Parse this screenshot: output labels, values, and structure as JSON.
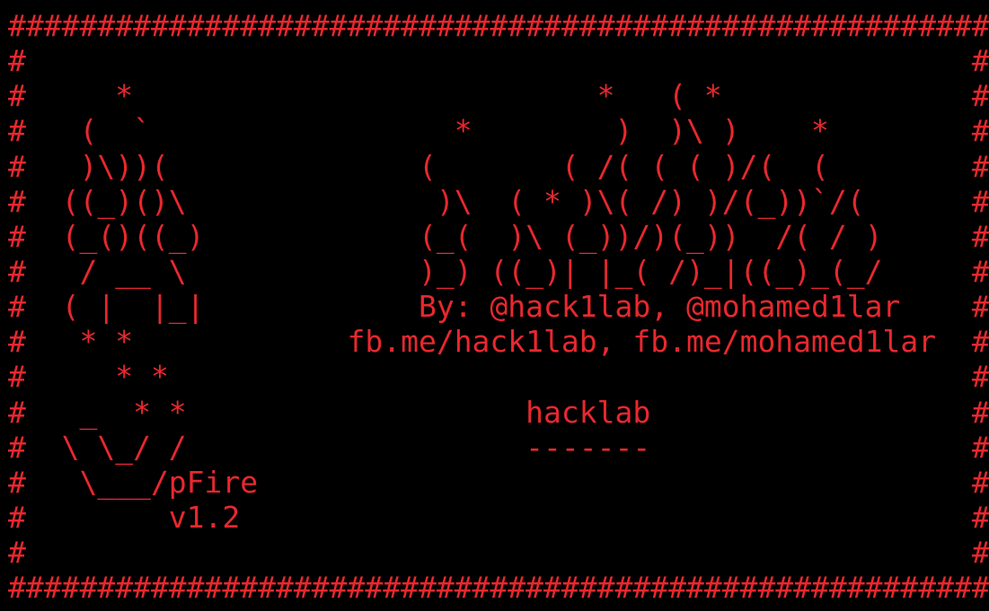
{
  "terminal": {
    "text_color": "#e8282e",
    "background_color": "#000000",
    "banner_lines": [
      "#######################################################",
      "#                                                     #",
      "#     *                          *   ( *              #",
      "#   (  `                 *        )  )\\ )    *        #",
      "#   )\\))(              (       ( /( ( ( )/(  (        #",
      "#  ((_)()\\              )\\  ( * )\\( /) )/(_))`/(      #",
      "#  (_()((_)            (_(  )\\ (_))/)(_))  /( / )     #",
      "#   / __ \\             )_) ((_)| |_( /)_|((_)_(_/     #",
      "#  ( |  |_|            By: @hack1lab, @mohamed1lar    #",
      "#   * *            fb.me/hack1lab, fb.me/mohamed1lar  #",
      "#     * *                                             #",
      "#   _  * *                   hacklab                  #",
      "#  \\ \\_/ /                   -------                  #",
      "#   \\___/pFire                                        #",
      "#        v1.2                                         #",
      "#                                                     #",
      "#######################################################"
    ]
  }
}
